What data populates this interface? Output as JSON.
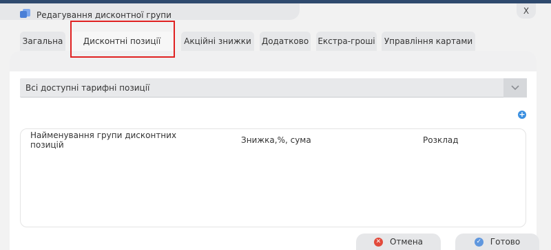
{
  "window": {
    "title": "Редагування дисконтної групи",
    "close_label": "X"
  },
  "tabs": [
    {
      "label": "Загальна"
    },
    {
      "label": "Дисконтні позиції"
    },
    {
      "label": "Акційні знижки"
    },
    {
      "label": "Додатково"
    },
    {
      "label": "Екстра-гроші"
    },
    {
      "label": "Управління картами"
    }
  ],
  "active_tab": "Дисконтні позиції",
  "tariff_select": {
    "value": "Всі доступні тарифні позиції"
  },
  "grid": {
    "columns": [
      {
        "label": "Найменування групи дисконтних позицій"
      },
      {
        "label": "Знижка,%, сума"
      },
      {
        "label": "Розклад"
      }
    ],
    "rows": []
  },
  "footer": {
    "cancel_label": "Отмена",
    "ok_label": "Готово"
  },
  "colors": {
    "highlight": "#e02020",
    "accent": "#3a8fe0",
    "cancel_icon": "#e24a3b"
  }
}
